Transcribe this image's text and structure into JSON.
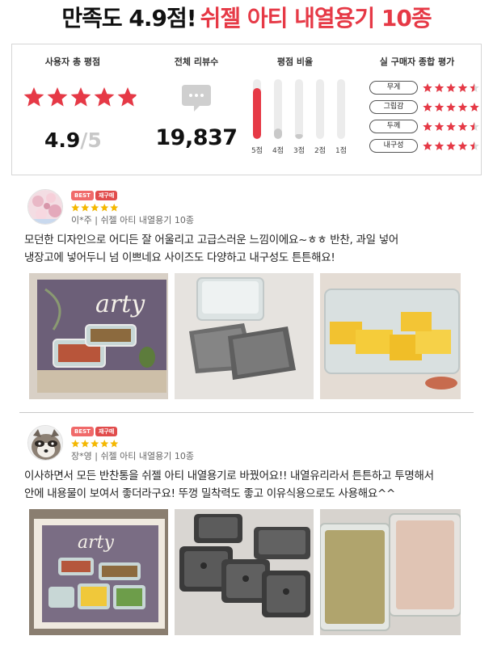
{
  "headline": {
    "black_part": "만족도 4.9점!",
    "red_part": "쉬젤 아티 내열용기 10종"
  },
  "summary": {
    "overall": {
      "title": "사용자 총 평점",
      "score": "4.9",
      "out_of": "/5",
      "rating_fraction": 0.98
    },
    "reviews": {
      "title": "전체 리뷰수",
      "count": "19,837",
      "icon": "speech-bubble-icon"
    },
    "distribution": {
      "title": "평점 비율",
      "bars": [
        {
          "label": "5점",
          "fill_fraction": 0.85,
          "color": "#e63946"
        },
        {
          "label": "4점",
          "fill_fraction": 0.18,
          "color": "#c9c9c9"
        },
        {
          "label": "3점",
          "fill_fraction": 0.08,
          "color": "#c9c9c9"
        },
        {
          "label": "2점",
          "fill_fraction": 0.0,
          "color": "#c9c9c9"
        },
        {
          "label": "1점",
          "fill_fraction": 0.0,
          "color": "#c9c9c9"
        }
      ]
    },
    "attributes": {
      "title": "실 구매자 종합 평가",
      "items": [
        {
          "label": "무게",
          "rating_fraction": 0.9
        },
        {
          "label": "그립감",
          "rating_fraction": 1.0
        },
        {
          "label": "두께",
          "rating_fraction": 0.9
        },
        {
          "label": "내구성",
          "rating_fraction": 0.9
        }
      ]
    }
  },
  "reviews": [
    {
      "badges": [
        "BEST",
        "재구매"
      ],
      "stars": 5,
      "meta": "이*주 | 쉬젤 아티 내열용기 10종",
      "lines": [
        "모던한 디자인으로 어디든 잘 어울리고 고급스러운 느낌이에요~ㅎㅎ 반찬, 과일 넣어",
        "냉장고에 넣어두니 넘 이쁘네요 사이즈도 다양하고 내구성도 튼튼해요!"
      ],
      "avatar": "blossom-avatar",
      "photos": [
        "arty-box-photo",
        "glass-lids-photo",
        "pineapple-container-photo"
      ]
    },
    {
      "badges": [
        "BEST",
        "재구매"
      ],
      "stars": 5,
      "meta": "장*영 | 쉬젤 아티 내열용기 10종",
      "lines": [
        "이사하면서 모든 반찬통을 쉬젤 아티 내열용기로 바꿨어요!! 내열유리라서 튼튼하고 투명해서",
        "안에 내용물이 보여서 좋더라구요! 뚜껑 밀착력도 좋고 이유식용으로도 사용해요^^"
      ],
      "avatar": "raccoon-avatar",
      "photos": [
        "arty-set-box-photo",
        "stacked-containers-photo",
        "baby-food-photo"
      ]
    }
  ],
  "colors": {
    "accent_red": "#e63946",
    "star_yellow": "#f5b800",
    "star_empty": "#d9d9d9"
  }
}
